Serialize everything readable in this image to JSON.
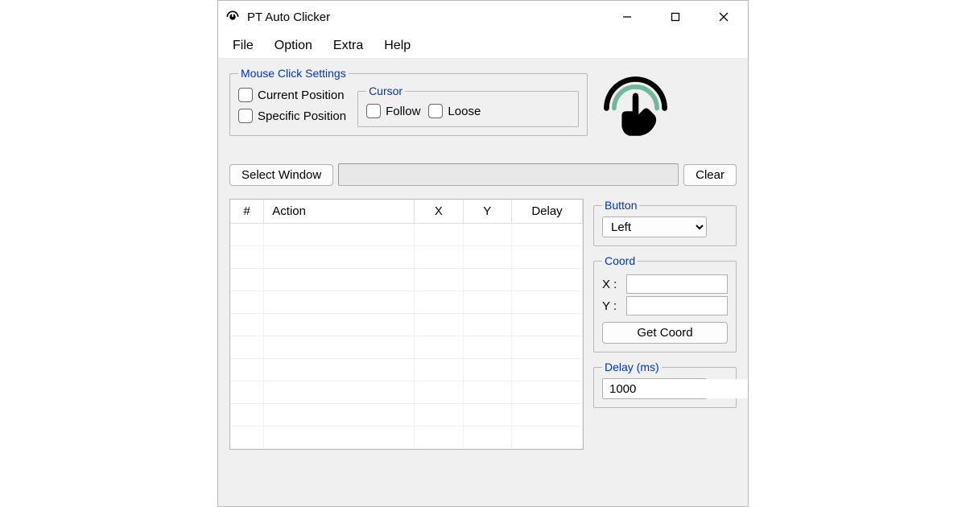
{
  "window": {
    "title": "PT Auto Clicker"
  },
  "menu": {
    "file": "File",
    "option": "Option",
    "extra": "Extra",
    "help": "Help"
  },
  "mouse_settings": {
    "legend": "Mouse Click Settings",
    "current_position": "Current Position",
    "specific_position": "Specific Position"
  },
  "cursor": {
    "legend": "Cursor",
    "follow": "Follow",
    "loose": "Loose"
  },
  "window_select": {
    "select_label": "Select Window",
    "clear_label": "Clear",
    "value": ""
  },
  "table": {
    "headers": {
      "num": "#",
      "action": "Action",
      "x": "X",
      "y": "Y",
      "delay": "Delay"
    }
  },
  "button_group": {
    "legend": "Button",
    "selected": "Left"
  },
  "coord": {
    "legend": "Coord",
    "x_label": "X :",
    "y_label": "Y :",
    "x_value": "",
    "y_value": "",
    "get_label": "Get Coord"
  },
  "delay": {
    "legend": "Delay (ms)",
    "value": "1000"
  }
}
